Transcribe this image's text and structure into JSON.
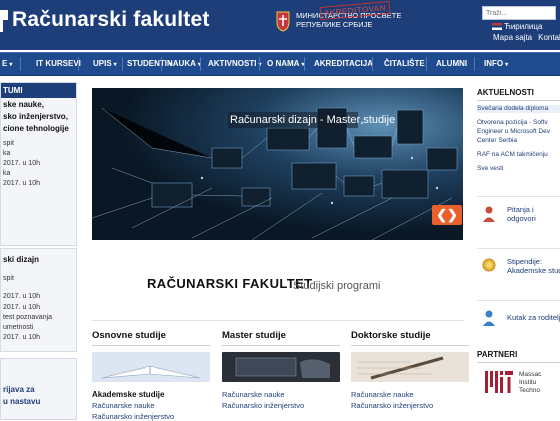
{
  "header": {
    "brand": "Računarski fakultet",
    "ministry_line1": "МИНИСТАРСТВО ПРОСВЕТЕ",
    "ministry_line2": "РЕПУБЛИКЕ СРБИЈЕ",
    "stamp": "AKREDITOVAN",
    "search_placeholder": "Traži...",
    "language": "Ћирилица",
    "site_map": "Mapa sajta",
    "contact": "Kontakt"
  },
  "nav": {
    "items": [
      {
        "label": "E",
        "has_menu": true
      },
      {
        "label": "IT KURSEVI",
        "has_menu": false
      },
      {
        "label": "UPIS",
        "has_menu": true
      },
      {
        "label": "STUDENTI",
        "has_menu": true
      },
      {
        "label": "NAUKA",
        "has_menu": true
      },
      {
        "label": "AKTIVNOSTI",
        "has_menu": true
      },
      {
        "label": "O NAMA",
        "has_menu": true
      },
      {
        "label": "AKREDITACIJA",
        "has_menu": false
      },
      {
        "label": "ČITALIŠTE",
        "has_menu": false
      },
      {
        "label": "ALUMNI",
        "has_menu": false
      },
      {
        "label": "INFO",
        "has_menu": true
      }
    ],
    "caret": "▾"
  },
  "left": {
    "events_head": "TUMI",
    "event1": {
      "title_lines": [
        "ske nauke,",
        "sko inženjerstvo,",
        "cione tehnologije"
      ],
      "lines": [
        "spit",
        "ka",
        "2017. u 10h",
        "ka",
        "2017. u 10h"
      ]
    },
    "event2": {
      "title_lines": [
        "ski dizajn"
      ],
      "lines": [
        "spit",
        "2017. u 10h",
        "",
        "2017. u 10h",
        "test poznavanja",
        "umetnosti",
        "2017. u 10h"
      ]
    },
    "event3": {
      "title_lines": [
        "rijava za",
        "u nastavu"
      ]
    }
  },
  "hero": {
    "caption": "Računarski dizajn - Master studije",
    "arrows": "❮❯"
  },
  "faculty": {
    "title": "RAČUNARSKI FAKULTET",
    "subtitle": "Studijski programi"
  },
  "columns": [
    {
      "head": "Osnovne studije",
      "sub": "Akademske studije",
      "links": [
        "Računarske nauke",
        "Računarsko inženjerstvo"
      ]
    },
    {
      "head": "Master studije",
      "sub": "",
      "links": [
        "Računarske nauke",
        "Računarsko inženjerstvo"
      ]
    },
    {
      "head": "Doktorske studije",
      "sub": "",
      "links": [
        "Računarske nauke",
        "Računarsko inženjerstvo"
      ]
    }
  ],
  "news": {
    "head": "AKTUELNOSTI",
    "items": [
      "Svečana dodela diploma",
      "Otvorena pozicija - Softv",
      "Engineer u Microsoft Dev",
      "Center Serbia",
      "RAF na ACM takmičenju",
      "Sve vesti"
    ]
  },
  "widgets": [
    {
      "line1": "Pitanja i",
      "line2": "odgovori",
      "icon": "question-person-icon"
    },
    {
      "line1": "Stipendije:",
      "line2": "Akademske studije",
      "icon": "medal-icon"
    },
    {
      "line1": "Kutak za roditelje",
      "line2": "",
      "icon": "parent-icon"
    }
  ],
  "partners": {
    "head": "PARTNERI",
    "mit_lines": [
      "Massac",
      "Institu",
      "Techno"
    ]
  },
  "colors": {
    "header_bg": "#1d3e78",
    "nav_bg": "#1f4a8d",
    "arrow_accent": "#e8602c",
    "link": "#1d3e78",
    "mit_red": "#a31f34"
  }
}
